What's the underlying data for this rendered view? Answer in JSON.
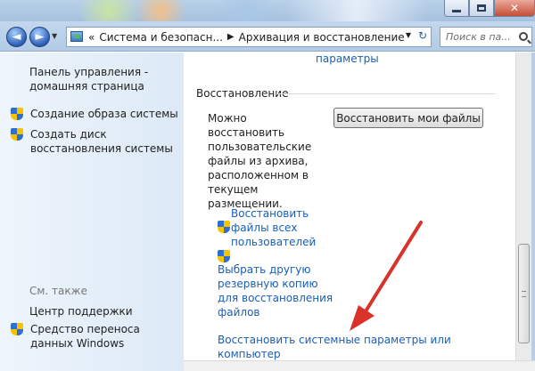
{
  "window": {
    "controls": {
      "minimize": "minimize",
      "maximize": "maximize",
      "close": "✕"
    }
  },
  "navigation": {
    "back": "◄",
    "forward": "►",
    "breadcrumbs": [
      "Система и безопасн...",
      "Архивация и восстановление"
    ],
    "crumb_prefix": "«",
    "search_placeholder": "Поиск в пa..."
  },
  "sidebar": {
    "home_link": "Панель управления - домашняя страница",
    "items": [
      {
        "label": "Создание образа системы",
        "icon": "uac-shield-icon"
      },
      {
        "label": "Создать диск восстановления системы",
        "icon": "uac-shield-icon"
      }
    ],
    "see_also_label": "См. также",
    "see_also": [
      {
        "label": "Центр поддержки"
      },
      {
        "label": "Средство переноса данных Windows",
        "icon": "uac-shield-icon"
      }
    ]
  },
  "main": {
    "top_link": "параметры",
    "section_title": "Восстановление",
    "description": "Можно восстановить пользовательские файлы из архива, расположенном в текущем размещении.",
    "restore_button": "Восстановить мои файлы",
    "links": [
      {
        "label": "Восстановить файлы всех пользователей",
        "icon": "uac-shield-icon"
      },
      {
        "label": "Выбрать другую резервную копию для восстановления файлов",
        "icon": "uac-shield-icon"
      },
      {
        "label": "Восстановить системные параметры или компьютер"
      }
    ]
  },
  "colors": {
    "link": "#1a5fb4",
    "sidebar_bg": "#e4eef9",
    "annotation_arrow": "#d8322a"
  }
}
